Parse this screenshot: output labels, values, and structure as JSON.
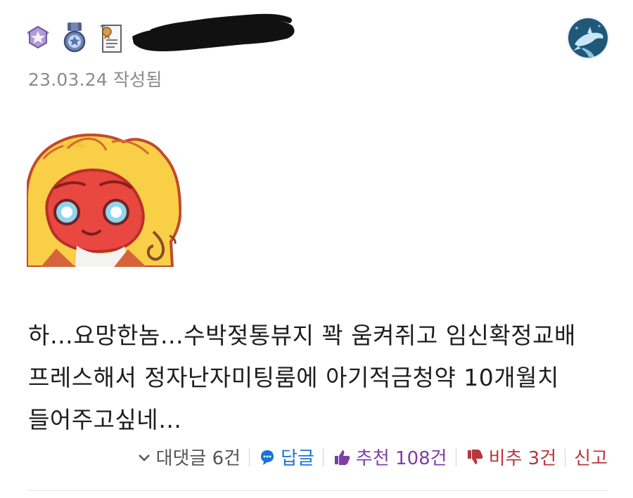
{
  "comment": {
    "date": "23.03.24",
    "date_suffix": "작성됨",
    "badges": [
      "purple-star-wing-badge-icon",
      "blue-star-medal-icon",
      "certificate-scroll-icon"
    ],
    "body_lines": [
      "하…요망한놈…수박젖통뷰지 꽉 움켜쥐고 임신확정교배",
      "프레스해서 정자난자미팅룸에 아기적금청약 10개월치",
      "들어주고싶네…"
    ],
    "actions": {
      "replies_label": "대댓글 6건",
      "reply_label": "답글",
      "upvote_label": "추천 108건",
      "downvote_label": "비추 3건",
      "report_label": "신고"
    }
  },
  "colors": {
    "date_gray": "#8b8b8b",
    "reply_blue": "#1a73d9",
    "upvote_purple": "#7d3fa3",
    "downvote_red": "#b8363d"
  }
}
